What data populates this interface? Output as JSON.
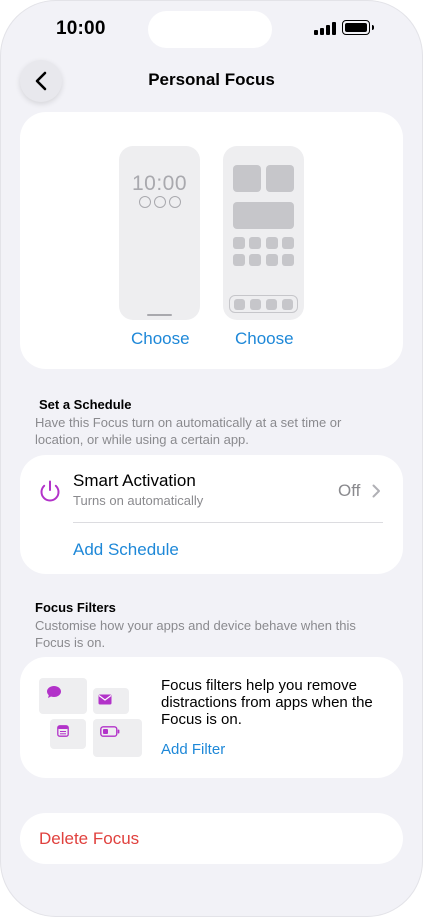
{
  "status_bar": {
    "time": "10:00"
  },
  "nav": {
    "title": "Personal Focus",
    "back_icon": "chevron-left-icon"
  },
  "previews": {
    "lock_screen": {
      "time": "10:00",
      "choose_label": "Choose"
    },
    "home_screen": {
      "choose_label": "Choose"
    }
  },
  "schedule": {
    "heading": "Set a Schedule",
    "description": "Have this Focus turn on automatically at a set time or location, or while using a certain app.",
    "smart_activation": {
      "title": "Smart Activation",
      "subtitle": "Turns on automatically",
      "value": "Off",
      "icon": "power-icon",
      "icon_color": "#b232c9"
    },
    "add_schedule_label": "Add Schedule"
  },
  "filters": {
    "heading": "Focus Filters",
    "description": "Customise how your apps and device behave when this Focus is on.",
    "info_text": "Focus filters help you remove distractions from apps when the Focus is on.",
    "add_filter_label": "Add Filter",
    "icon_color": "#b232c9",
    "icons": [
      "message-icon",
      "mail-icon",
      "calendar-icon",
      "battery-icon"
    ]
  },
  "delete": {
    "label": "Delete Focus",
    "color": "#e0413e"
  },
  "colors": {
    "accent": "#1e88d8",
    "background": "#f2f2f7",
    "secondary_text": "#8a8a8e"
  }
}
